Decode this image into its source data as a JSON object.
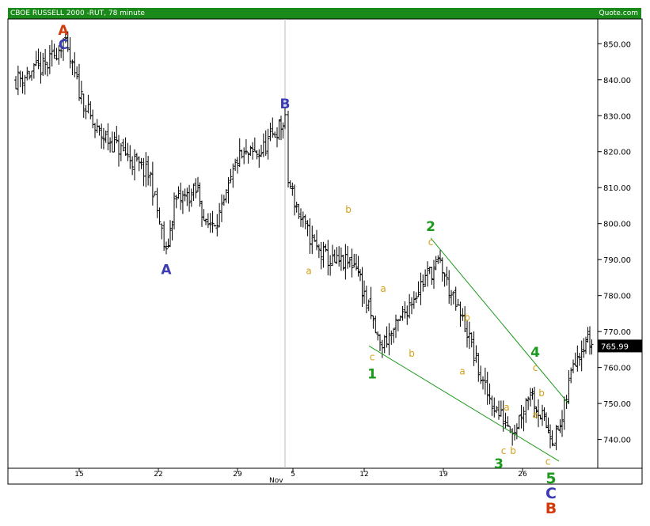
{
  "header": {
    "title": "CBOE RUSSELL 2000  -RUT, 78 minute",
    "source": "Quote.com"
  },
  "colors": {
    "wave": "#1a9a1a",
    "sub": "#d4a017",
    "blue": "#3b3bb3",
    "red": "#d43a0a",
    "header": "#1a8a1a"
  },
  "chart_data": {
    "type": "ohlc",
    "title": "CBOE RUSSELL 2000  -RUT, 78 minute",
    "ylim": [
      732,
      856
    ],
    "xlim": [
      0,
      36
    ],
    "yticks": [
      740,
      750,
      760,
      770,
      780,
      790,
      800,
      810,
      820,
      830,
      840,
      850
    ],
    "ytick_labels": [
      "740.00",
      "750.00",
      "760.00",
      "770.00",
      "780.00",
      "790.00",
      "800.00",
      "810.00",
      "820.00",
      "830.00",
      "840.00",
      "850.00"
    ],
    "xticks": [
      {
        "x": 4,
        "label": "15"
      },
      {
        "x": 9,
        "label": "22"
      },
      {
        "x": 14,
        "label": "29"
      },
      {
        "x": 17.5,
        "label": "5",
        "sub": "Nov"
      },
      {
        "x": 22,
        "label": "12"
      },
      {
        "x": 27,
        "label": "19"
      },
      {
        "x": 32,
        "label": "26"
      }
    ],
    "divider_x": 17,
    "last": {
      "value": 765.99,
      "label": "765.99"
    },
    "path": [
      [
        0,
        840
      ],
      [
        2,
        844
      ],
      [
        3,
        851
      ],
      [
        4,
        837
      ],
      [
        5,
        826
      ],
      [
        6.5,
        821
      ],
      [
        7.5,
        817
      ],
      [
        8.5,
        813
      ],
      [
        9.5,
        791
      ],
      [
        10,
        806
      ],
      [
        11.5,
        809
      ],
      [
        12,
        799
      ],
      [
        13,
        803
      ],
      [
        14,
        818
      ],
      [
        15.5,
        820
      ],
      [
        16.5,
        826
      ],
      [
        17,
        828
      ],
      [
        17.2,
        812
      ],
      [
        18,
        801
      ],
      [
        19,
        793
      ],
      [
        20,
        789
      ],
      [
        21.5,
        789
      ],
      [
        22,
        780
      ],
      [
        23,
        766
      ],
      [
        24,
        771
      ],
      [
        25,
        779
      ],
      [
        26,
        786
      ],
      [
        26.8,
        789
      ],
      [
        27.5,
        780
      ],
      [
        28.5,
        770
      ],
      [
        29.5,
        755
      ],
      [
        30.5,
        747
      ],
      [
        31.5,
        743
      ],
      [
        32.5,
        754
      ],
      [
        33,
        748
      ],
      [
        33.5,
        744
      ],
      [
        34,
        740
      ],
      [
        34.5,
        745
      ],
      [
        35.2,
        762
      ],
      [
        36,
        768
      ],
      [
        36.5,
        766
      ]
    ],
    "channel_lines": [
      {
        "from": [
          22.3,
          766
        ],
        "to": [
          34.3,
          734
        ]
      },
      {
        "from": [
          26.2,
          796
        ],
        "to": [
          34.9,
          750
        ]
      }
    ],
    "annotations": [
      {
        "text": "A",
        "x": 3,
        "y": 852.5,
        "color": "red",
        "size": 17,
        "bold": true
      },
      {
        "text": "C",
        "x": 3,
        "y": 848.5,
        "color": "blue",
        "size": 17,
        "bold": true
      },
      {
        "text": "B",
        "x": 17,
        "y": 832,
        "color": "blue",
        "size": 17,
        "bold": true
      },
      {
        "text": "A",
        "x": 9.5,
        "y": 786,
        "color": "blue",
        "size": 17,
        "bold": true
      },
      {
        "text": "a",
        "x": 18.5,
        "y": 786,
        "color": "sub",
        "size": 12
      },
      {
        "text": "b",
        "x": 21,
        "y": 803,
        "color": "sub",
        "size": 12
      },
      {
        "text": "a",
        "x": 23.2,
        "y": 781,
        "color": "sub",
        "size": 12
      },
      {
        "text": "c",
        "x": 22.5,
        "y": 762,
        "color": "sub",
        "size": 12
      },
      {
        "text": "1",
        "x": 22.5,
        "y": 757,
        "color": "wave",
        "size": 17,
        "bold": true
      },
      {
        "text": "b",
        "x": 25,
        "y": 763,
        "color": "sub",
        "size": 12
      },
      {
        "text": "2",
        "x": 26.2,
        "y": 798,
        "color": "wave",
        "size": 17,
        "bold": true
      },
      {
        "text": "c",
        "x": 26.2,
        "y": 794,
        "color": "sub",
        "size": 12
      },
      {
        "text": "b",
        "x": 28.5,
        "y": 773,
        "color": "sub",
        "size": 12
      },
      {
        "text": "a",
        "x": 28.2,
        "y": 758,
        "color": "sub",
        "size": 12
      },
      {
        "text": "a",
        "x": 31,
        "y": 748,
        "color": "sub",
        "size": 12
      },
      {
        "text": "c",
        "x": 30.8,
        "y": 736,
        "color": "sub",
        "size": 12
      },
      {
        "text": "b",
        "x": 31.4,
        "y": 736,
        "color": "sub",
        "size": 12
      },
      {
        "text": "3",
        "x": 30.5,
        "y": 732,
        "color": "wave",
        "size": 17,
        "bold": true
      },
      {
        "text": "4",
        "x": 32.8,
        "y": 763,
        "color": "wave",
        "size": 17,
        "bold": true
      },
      {
        "text": "c",
        "x": 32.8,
        "y": 759,
        "color": "sub",
        "size": 12
      },
      {
        "text": "b",
        "x": 33.2,
        "y": 752,
        "color": "sub",
        "size": 12
      },
      {
        "text": "a",
        "x": 32.8,
        "y": 746,
        "color": "sub",
        "size": 12
      },
      {
        "text": "c",
        "x": 33.6,
        "y": 733,
        "color": "sub",
        "size": 12
      }
    ],
    "below_annotations": [
      {
        "text": "5",
        "x": 33.8,
        "dy": 19,
        "color": "wave"
      },
      {
        "text": "C",
        "x": 33.8,
        "dy": 38,
        "color": "blue"
      },
      {
        "text": "B",
        "x": 33.8,
        "dy": 57,
        "color": "red"
      }
    ]
  }
}
